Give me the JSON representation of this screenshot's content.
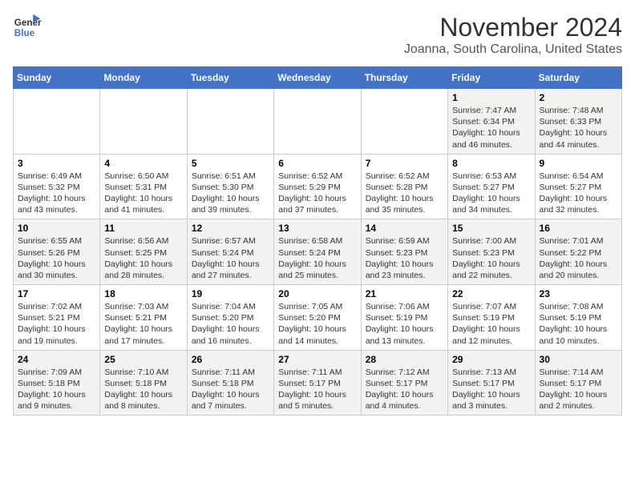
{
  "header": {
    "logo_line1": "General",
    "logo_line2": "Blue",
    "month": "November 2024",
    "location": "Joanna, South Carolina, United States"
  },
  "weekdays": [
    "Sunday",
    "Monday",
    "Tuesday",
    "Wednesday",
    "Thursday",
    "Friday",
    "Saturday"
  ],
  "weeks": [
    [
      {
        "day": "",
        "info": ""
      },
      {
        "day": "",
        "info": ""
      },
      {
        "day": "",
        "info": ""
      },
      {
        "day": "",
        "info": ""
      },
      {
        "day": "",
        "info": ""
      },
      {
        "day": "1",
        "info": "Sunrise: 7:47 AM\nSunset: 6:34 PM\nDaylight: 10 hours and 46 minutes."
      },
      {
        "day": "2",
        "info": "Sunrise: 7:48 AM\nSunset: 6:33 PM\nDaylight: 10 hours and 44 minutes."
      }
    ],
    [
      {
        "day": "3",
        "info": "Sunrise: 6:49 AM\nSunset: 5:32 PM\nDaylight: 10 hours and 43 minutes."
      },
      {
        "day": "4",
        "info": "Sunrise: 6:50 AM\nSunset: 5:31 PM\nDaylight: 10 hours and 41 minutes."
      },
      {
        "day": "5",
        "info": "Sunrise: 6:51 AM\nSunset: 5:30 PM\nDaylight: 10 hours and 39 minutes."
      },
      {
        "day": "6",
        "info": "Sunrise: 6:52 AM\nSunset: 5:29 PM\nDaylight: 10 hours and 37 minutes."
      },
      {
        "day": "7",
        "info": "Sunrise: 6:52 AM\nSunset: 5:28 PM\nDaylight: 10 hours and 35 minutes."
      },
      {
        "day": "8",
        "info": "Sunrise: 6:53 AM\nSunset: 5:27 PM\nDaylight: 10 hours and 34 minutes."
      },
      {
        "day": "9",
        "info": "Sunrise: 6:54 AM\nSunset: 5:27 PM\nDaylight: 10 hours and 32 minutes."
      }
    ],
    [
      {
        "day": "10",
        "info": "Sunrise: 6:55 AM\nSunset: 5:26 PM\nDaylight: 10 hours and 30 minutes."
      },
      {
        "day": "11",
        "info": "Sunrise: 6:56 AM\nSunset: 5:25 PM\nDaylight: 10 hours and 28 minutes."
      },
      {
        "day": "12",
        "info": "Sunrise: 6:57 AM\nSunset: 5:24 PM\nDaylight: 10 hours and 27 minutes."
      },
      {
        "day": "13",
        "info": "Sunrise: 6:58 AM\nSunset: 5:24 PM\nDaylight: 10 hours and 25 minutes."
      },
      {
        "day": "14",
        "info": "Sunrise: 6:59 AM\nSunset: 5:23 PM\nDaylight: 10 hours and 23 minutes."
      },
      {
        "day": "15",
        "info": "Sunrise: 7:00 AM\nSunset: 5:23 PM\nDaylight: 10 hours and 22 minutes."
      },
      {
        "day": "16",
        "info": "Sunrise: 7:01 AM\nSunset: 5:22 PM\nDaylight: 10 hours and 20 minutes."
      }
    ],
    [
      {
        "day": "17",
        "info": "Sunrise: 7:02 AM\nSunset: 5:21 PM\nDaylight: 10 hours and 19 minutes."
      },
      {
        "day": "18",
        "info": "Sunrise: 7:03 AM\nSunset: 5:21 PM\nDaylight: 10 hours and 17 minutes."
      },
      {
        "day": "19",
        "info": "Sunrise: 7:04 AM\nSunset: 5:20 PM\nDaylight: 10 hours and 16 minutes."
      },
      {
        "day": "20",
        "info": "Sunrise: 7:05 AM\nSunset: 5:20 PM\nDaylight: 10 hours and 14 minutes."
      },
      {
        "day": "21",
        "info": "Sunrise: 7:06 AM\nSunset: 5:19 PM\nDaylight: 10 hours and 13 minutes."
      },
      {
        "day": "22",
        "info": "Sunrise: 7:07 AM\nSunset: 5:19 PM\nDaylight: 10 hours and 12 minutes."
      },
      {
        "day": "23",
        "info": "Sunrise: 7:08 AM\nSunset: 5:19 PM\nDaylight: 10 hours and 10 minutes."
      }
    ],
    [
      {
        "day": "24",
        "info": "Sunrise: 7:09 AM\nSunset: 5:18 PM\nDaylight: 10 hours and 9 minutes."
      },
      {
        "day": "25",
        "info": "Sunrise: 7:10 AM\nSunset: 5:18 PM\nDaylight: 10 hours and 8 minutes."
      },
      {
        "day": "26",
        "info": "Sunrise: 7:11 AM\nSunset: 5:18 PM\nDaylight: 10 hours and 7 minutes."
      },
      {
        "day": "27",
        "info": "Sunrise: 7:11 AM\nSunset: 5:17 PM\nDaylight: 10 hours and 5 minutes."
      },
      {
        "day": "28",
        "info": "Sunrise: 7:12 AM\nSunset: 5:17 PM\nDaylight: 10 hours and 4 minutes."
      },
      {
        "day": "29",
        "info": "Sunrise: 7:13 AM\nSunset: 5:17 PM\nDaylight: 10 hours and 3 minutes."
      },
      {
        "day": "30",
        "info": "Sunrise: 7:14 AM\nSunset: 5:17 PM\nDaylight: 10 hours and 2 minutes."
      }
    ]
  ]
}
